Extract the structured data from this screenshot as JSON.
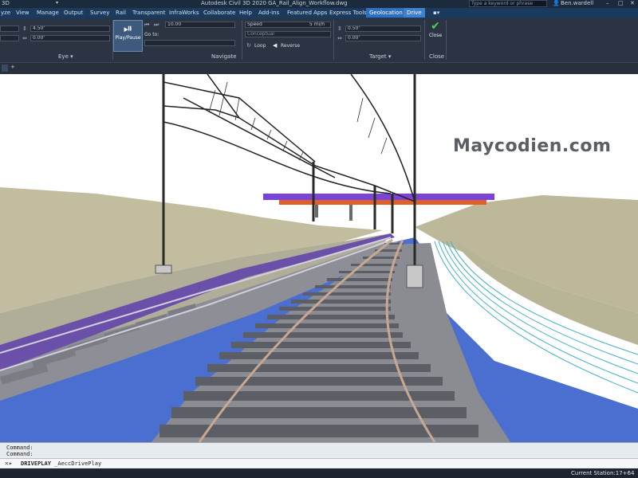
{
  "titlebar": {
    "workspace": "3D",
    "title": "Autodesk Civil 3D 2020   GA_Rail_Align_Workflow.dwg",
    "search_placeholder": "Type a keyword or phrase",
    "user": "Ben.wardell",
    "minimize": "–",
    "maximize": "□",
    "close": "✕"
  },
  "tabs": [
    {
      "label": "yze"
    },
    {
      "label": "View"
    },
    {
      "label": "Manage"
    },
    {
      "label": "Output"
    },
    {
      "label": "Survey"
    },
    {
      "label": "Rail"
    },
    {
      "label": "Transparent"
    },
    {
      "label": "InfraWorks"
    },
    {
      "label": "Collaborate"
    },
    {
      "label": "Help"
    },
    {
      "label": "Add-ins"
    },
    {
      "label": "Featured Apps"
    },
    {
      "label": "Express Tools"
    },
    {
      "label": "Geolocation"
    },
    {
      "label": "Drive"
    }
  ],
  "ribbon": {
    "eye": {
      "height_value": "4.50'",
      "offset_value": "0.00'",
      "panel_title": "Eye ▾"
    },
    "play_pause_label": "Play/Pause",
    "navigate": {
      "station_value": "10.00",
      "goto_label": "Go to:",
      "panel_title": "Navigate"
    },
    "speed": {
      "label": "Speed",
      "value": "5 mi/h",
      "style_value": "Conceptual",
      "loop_label": "Loop",
      "reverse_label": "Reverse"
    },
    "target": {
      "height_value": "0.50'",
      "offset_value": "0.00'",
      "panel_title": "Target ▾"
    },
    "close": {
      "label": "Close",
      "panel_title": "Close"
    }
  },
  "docbar": {
    "add_tab": "+"
  },
  "viewport": {
    "watermark": "Maycodien.com"
  },
  "command": {
    "history": [
      "Command:",
      "Command:"
    ],
    "prompt": "DRIVEPLAY",
    "prompt_rest": " _AeccDrivePlay"
  },
  "status": {
    "station": "Current Station:17+64"
  },
  "colors": {
    "ribbon_bg": "#2b3442",
    "tab_bg": "#1a3a5e",
    "geolocation_tab": "#2f6fc0",
    "terrain": "#bdb89a",
    "ballast_blue": "#4a6fd0",
    "bridge_purple": "#7a44d8",
    "bridge_orange": "#e0602a"
  }
}
